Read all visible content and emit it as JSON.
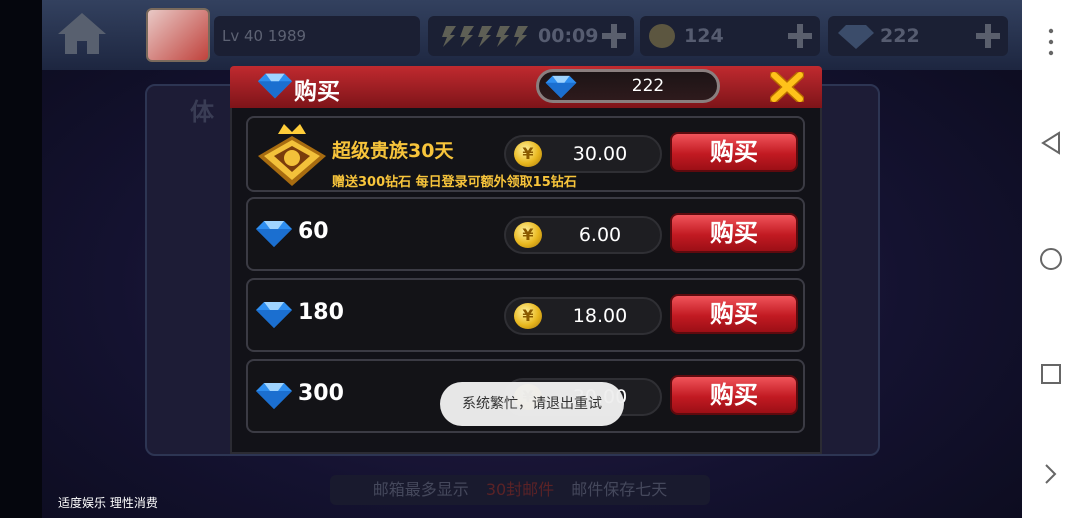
{
  "hud": {
    "level_text": "Lv 40 1989",
    "energy_timer": "00:09",
    "gold_count": "124",
    "diamond_count": "222"
  },
  "background": {
    "panel_title": "体",
    "mail_note_prefix": "邮箱最多显示",
    "mail_note_highlight": "30封邮件",
    "mail_note_suffix": "邮件保存七天",
    "health_notice": "适度娱乐 理性消费"
  },
  "dialog": {
    "title": "购买",
    "balance": "222",
    "close_icon": "close-x-icon",
    "items": [
      {
        "kind": "vip",
        "name": "超级贵族30天",
        "desc": "赠送300钻石  每日登录可额外领取15钻石",
        "price": "30.00",
        "buy_label": "购买"
      },
      {
        "kind": "diamond",
        "amount": "60",
        "price": "6.00",
        "buy_label": "购买"
      },
      {
        "kind": "diamond",
        "amount": "180",
        "price": "18.00",
        "buy_label": "购买"
      },
      {
        "kind": "diamond",
        "amount": "300",
        "price": "30.00",
        "buy_label": "购买"
      }
    ]
  },
  "toast": {
    "message": "系统繁忙，请退出重试"
  },
  "colors": {
    "header_red": "#c02a2f",
    "buy_red": "#d9252c",
    "vip_gold": "#f7c43b",
    "diamond_blue": "#3aa0ff"
  },
  "icons": {
    "coin": "yuan-coin-icon",
    "gem": "diamond-icon",
    "home": "home-icon"
  }
}
